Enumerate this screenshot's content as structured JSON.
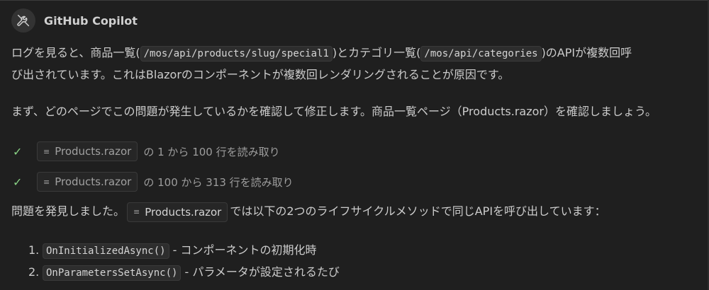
{
  "header": {
    "app_name": "GitHub Copilot",
    "avatar_icon": "tools-icon"
  },
  "para1": {
    "line1": {
      "t1": "ログを見ると、商品一覧(",
      "code1": "/mos/api/products/slug/special1",
      "t2": ")とカテゴリ一覧(",
      "code2": "/mos/api/categories",
      "t3": ")のAPIが複数回呼"
    },
    "line2": "び出されています。これはBlazorのコンポーネントが複数回レンダリングされることが原因です。"
  },
  "para2": "まず、どのページでこの問題が発生しているかを確認して修正します。商品一覧ページ（Products.razor）を確認しましょう。",
  "actions": [
    {
      "file": "Products.razor",
      "suffix": "の 1 から 100 行を読み取り",
      "status_icon": "check-icon"
    },
    {
      "file": "Products.razor",
      "suffix": "の 100 から 313 行を読み取り",
      "status_icon": "check-icon"
    }
  ],
  "para3": {
    "t1": "問題を発見しました。",
    "file": "Products.razor",
    "t2": "では以下の2つのライフサイクルメソッドで同じAPIを呼び出しています："
  },
  "list": [
    {
      "num": "1.",
      "code": "OnInitializedAsync()",
      "text": "- コンポーネントの初期化時"
    },
    {
      "num": "2.",
      "code": "OnParametersSetAsync()",
      "text": "- パラメータが設定されるたび"
    }
  ],
  "colors": {
    "background": "#1f1f1f",
    "check": "#89d185",
    "text": "#cccccc"
  }
}
